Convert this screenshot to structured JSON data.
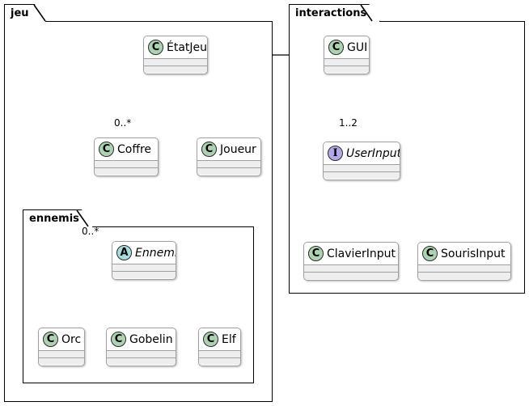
{
  "diagram": {
    "kind": "uml-class-diagram",
    "title": "",
    "background": "#ffffff",
    "line_color": "#000000",
    "class_border_color": "#A0A0A0",
    "class_fill_color": "#FEFEFE",
    "class_section_fill": "#EEEEEE",
    "stereotype_colors": {
      "class": "#ADD1B2",
      "abstract": "#A9DCDF",
      "interface": "#B4A7E5"
    }
  },
  "packages": [
    {
      "id": "jeu",
      "label": "jeu"
    },
    {
      "id": "ennemis",
      "label": "ennemis"
    },
    {
      "id": "interactions",
      "label": "interactions"
    }
  ],
  "classes": [
    {
      "id": "etatjeu",
      "name": "ÉtatJeu",
      "stereotype": "C",
      "stereotype_kind": "class",
      "package": "jeu",
      "italic": false
    },
    {
      "id": "coffre",
      "name": "Coffre",
      "stereotype": "C",
      "stereotype_kind": "class",
      "package": "jeu",
      "italic": false
    },
    {
      "id": "joueur",
      "name": "Joueur",
      "stereotype": "C",
      "stereotype_kind": "class",
      "package": "jeu",
      "italic": false
    },
    {
      "id": "ennemi",
      "name": "Ennemi",
      "stereotype": "A",
      "stereotype_kind": "abstract",
      "package": "ennemis",
      "italic": true
    },
    {
      "id": "orc",
      "name": "Orc",
      "stereotype": "C",
      "stereotype_kind": "class",
      "package": "ennemis",
      "italic": false
    },
    {
      "id": "gobelin",
      "name": "Gobelin",
      "stereotype": "C",
      "stereotype_kind": "class",
      "package": "ennemis",
      "italic": false
    },
    {
      "id": "elf",
      "name": "Elf",
      "stereotype": "C",
      "stereotype_kind": "class",
      "package": "ennemis",
      "italic": false
    },
    {
      "id": "gui",
      "name": "GUI",
      "stereotype": "C",
      "stereotype_kind": "class",
      "package": "interactions",
      "italic": false
    },
    {
      "id": "userinput",
      "name": "UserInput",
      "stereotype": "I",
      "stereotype_kind": "interface",
      "package": "interactions",
      "italic": true
    },
    {
      "id": "clavierinput",
      "name": "ClavierInput",
      "stereotype": "C",
      "stereotype_kind": "class",
      "package": "interactions",
      "italic": false
    },
    {
      "id": "sourisinput",
      "name": "SourisInput",
      "stereotype": "C",
      "stereotype_kind": "class",
      "package": "interactions",
      "italic": false
    }
  ],
  "relationships": [
    {
      "id": "etatjeu-ennemi",
      "from": "etatjeu",
      "to": "ennemi",
      "type": "composition",
      "label": "0..*"
    },
    {
      "id": "etatjeu-coffre",
      "from": "etatjeu",
      "to": "coffre",
      "type": "composition",
      "label": "0..*"
    },
    {
      "id": "etatjeu-joueur",
      "from": "etatjeu",
      "to": "joueur",
      "type": "composition",
      "label": ""
    },
    {
      "id": "etatjeu-gui",
      "from": "etatjeu",
      "to": "gui",
      "type": "association",
      "label": ""
    },
    {
      "id": "joueur-coffre",
      "from": "joueur",
      "to": "coffre",
      "type": "dependency",
      "label": ""
    },
    {
      "id": "joueur-ennemi",
      "from": "joueur",
      "to": "ennemi",
      "type": "association",
      "label": ""
    },
    {
      "id": "orc-ennemi",
      "from": "orc",
      "to": "ennemi",
      "type": "inheritance",
      "label": ""
    },
    {
      "id": "gobelin-ennemi",
      "from": "gobelin",
      "to": "ennemi",
      "type": "inheritance",
      "label": ""
    },
    {
      "id": "elf-ennemi",
      "from": "elf",
      "to": "ennemi",
      "type": "inheritance",
      "label": ""
    },
    {
      "id": "gui-userinput",
      "from": "gui",
      "to": "userinput",
      "type": "composition",
      "label": "1..2"
    },
    {
      "id": "clavier-userinput",
      "from": "clavierinput",
      "to": "userinput",
      "type": "realization",
      "label": ""
    },
    {
      "id": "souris-userinput",
      "from": "sourisinput",
      "to": "userinput",
      "type": "realization",
      "label": ""
    }
  ],
  "edge_labels": {
    "etatjeu_coffre_mult": "0..*",
    "etatjeu_ennemi_mult": "0..*",
    "gui_userinput_mult": "1..2"
  }
}
